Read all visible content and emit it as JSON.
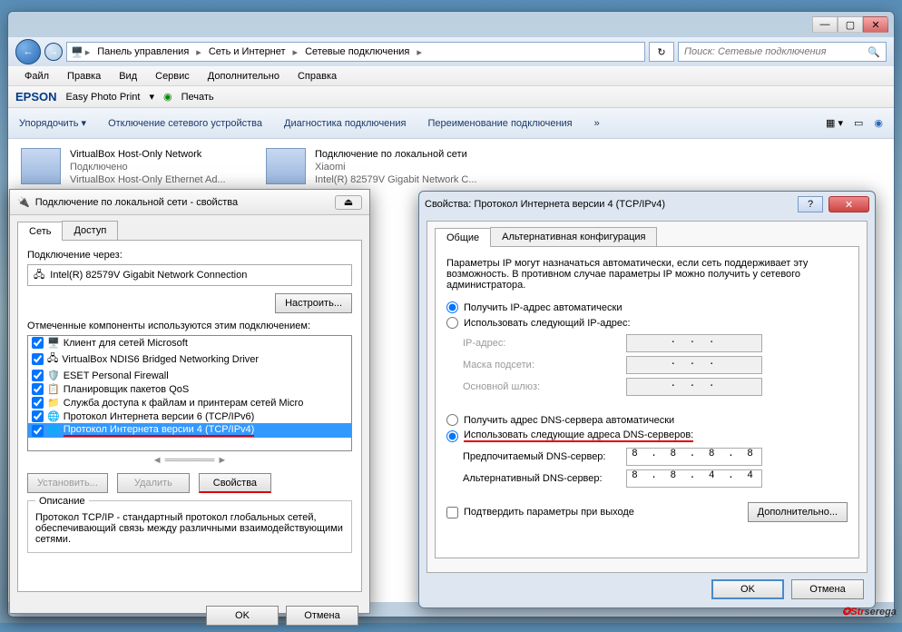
{
  "titlebar": {
    "min": "—",
    "max": "▢",
    "close": "✕"
  },
  "nav": {
    "back": "←",
    "fwd": "→"
  },
  "breadcrumb": {
    "a": "Панель управления",
    "b": "Сеть и Интернет",
    "c": "Сетевые подключения",
    "sep": "▸"
  },
  "search": {
    "placeholder": "Поиск: Сетевые подключения",
    "icon": "🔍"
  },
  "refresh": "↻",
  "menu": {
    "file": "Файл",
    "edit": "Правка",
    "view": "Вид",
    "service": "Сервис",
    "extra": "Дополнительно",
    "help": "Справка"
  },
  "epson": {
    "logo": "EPSON",
    "photo": "Easy Photo Print",
    "print": "Печать",
    "dd": "▾"
  },
  "toolbar": {
    "org": "Упорядочить",
    "org_dd": "▾",
    "disable": "Отключение сетевого устройства",
    "diag": "Диагностика подключения",
    "rename": "Переименование подключения",
    "more": "»"
  },
  "connections": [
    {
      "name": "VirtualBox Host-Only Network",
      "status": "Подключено",
      "adapter": "VirtualBox Host-Only Ethernet Ad..."
    },
    {
      "name": "Подключение по локальной сети",
      "status": "Xiaomi",
      "adapter": "Intel(R) 82579V Gigabit Network C..."
    }
  ],
  "dlg1": {
    "title": "Подключение по локальной сети - свойства",
    "eject": "⏏",
    "tabs": {
      "net": "Сеть",
      "access": "Доступ"
    },
    "conn_via": "Подключение через:",
    "adapter": "Intel(R) 82579V Gigabit Network Connection",
    "configure": "Настроить...",
    "checked_label": "Отмеченные компоненты используются этим подключением:",
    "components": [
      "Клиент для сетей Microsoft",
      "VirtualBox NDIS6 Bridged Networking Driver",
      "ESET Personal Firewall",
      "Планировщик пакетов QoS",
      "Служба доступа к файлам и принтерам сетей Micro",
      "Протокол Интернета версии 6 (TCP/IPv6)",
      "Протокол Интернета версии 4 (TCP/IPv4)"
    ],
    "install": "Установить...",
    "remove": "Удалить",
    "props": "Свойства",
    "desc_title": "Описание",
    "desc_text": "Протокол TCP/IP - стандартный протокол глобальных сетей, обеспечивающий связь между различными взаимодействующими сетями.",
    "ok": "OK",
    "cancel": "Отмена"
  },
  "dlg2": {
    "title": "Свойства: Протокол Интернета версии 4 (TCP/IPv4)",
    "help": "?",
    "close": "✕",
    "tabs": {
      "general": "Общие",
      "alt": "Альтернативная конфигурация"
    },
    "intro": "Параметры IP могут назначаться автоматически, если сеть поддерживает эту возможность. В противном случае параметры IP можно получить у сетевого администратора.",
    "r1": "Получить IP-адрес автоматически",
    "r2": "Использовать следующий IP-адрес:",
    "ip_label": "IP-адрес:",
    "mask_label": "Маска подсети:",
    "gw_label": "Основной шлюз:",
    "ip_val": ".   .   .",
    "mask_val": ".   .   .",
    "gw_val": ".   .   .",
    "r3": "Получить адрес DNS-сервера автоматически",
    "r4": "Использовать следующие адреса DNS-серверов:",
    "dns1_label": "Предпочитаемый DNS-сервер:",
    "dns1_val": "8 . 8 . 8 . 8",
    "dns2_label": "Альтернативный DNS-сервер:",
    "dns2_val": "8 . 8 . 4 . 4",
    "confirm": "Подтвердить параметры при выходе",
    "advanced": "Дополнительно...",
    "ok": "OK",
    "cancel": "Отмена"
  },
  "watermark": {
    "a": "Str",
    "b": "serega"
  }
}
